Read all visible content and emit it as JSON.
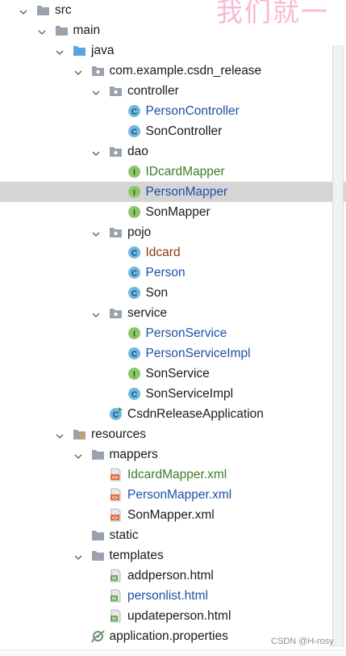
{
  "watermark": {
    "top": "我们就一",
    "bottom": "CSDN @H-rosy"
  },
  "tree": [
    {
      "label": "src",
      "depth": 0,
      "expanded": true,
      "icon": "folder-icon"
    },
    {
      "label": "main",
      "depth": 1,
      "expanded": true,
      "icon": "folder-icon"
    },
    {
      "label": "java",
      "depth": 2,
      "expanded": true,
      "icon": "source-folder-icon"
    },
    {
      "label": "com.example.csdn_release",
      "depth": 3,
      "expanded": true,
      "icon": "package-icon"
    },
    {
      "label": "controller",
      "depth": 4,
      "expanded": true,
      "icon": "package-icon"
    },
    {
      "label": "PersonController",
      "depth": 5,
      "icon": "class-icon",
      "color": "blue"
    },
    {
      "label": "SonController",
      "depth": 5,
      "icon": "class-icon"
    },
    {
      "label": "dao",
      "depth": 4,
      "expanded": true,
      "icon": "package-icon"
    },
    {
      "label": "IDcardMapper",
      "depth": 5,
      "icon": "interface-icon",
      "color": "green"
    },
    {
      "label": "PersonMapper",
      "depth": 5,
      "icon": "interface-icon",
      "color": "blue",
      "selected": true
    },
    {
      "label": "SonMapper",
      "depth": 5,
      "icon": "interface-icon"
    },
    {
      "label": "pojo",
      "depth": 4,
      "expanded": true,
      "icon": "package-icon"
    },
    {
      "label": "Idcard",
      "depth": 5,
      "icon": "class-icon",
      "color": "brown"
    },
    {
      "label": "Person",
      "depth": 5,
      "icon": "class-icon",
      "color": "blue"
    },
    {
      "label": "Son",
      "depth": 5,
      "icon": "class-icon"
    },
    {
      "label": "service",
      "depth": 4,
      "expanded": true,
      "icon": "package-icon"
    },
    {
      "label": "PersonService",
      "depth": 5,
      "icon": "interface-icon",
      "color": "blue"
    },
    {
      "label": "PersonServiceImpl",
      "depth": 5,
      "icon": "class-icon",
      "color": "blue"
    },
    {
      "label": "SonService",
      "depth": 5,
      "icon": "interface-icon"
    },
    {
      "label": "SonServiceImpl",
      "depth": 5,
      "icon": "class-icon"
    },
    {
      "label": "CsdnReleaseApplication",
      "depth": 4,
      "icon": "spring-boot-class-icon"
    },
    {
      "label": "resources",
      "depth": 2,
      "expanded": true,
      "icon": "resources-folder-icon"
    },
    {
      "label": "mappers",
      "depth": 3,
      "expanded": true,
      "icon": "folder-icon"
    },
    {
      "label": "IdcardMapper.xml",
      "depth": 4,
      "icon": "xml-file-icon",
      "color": "green"
    },
    {
      "label": "PersonMapper.xml",
      "depth": 4,
      "icon": "xml-file-icon",
      "color": "blue"
    },
    {
      "label": "SonMapper.xml",
      "depth": 4,
      "icon": "xml-file-icon"
    },
    {
      "label": "static",
      "depth": 3,
      "icon": "folder-icon"
    },
    {
      "label": "templates",
      "depth": 3,
      "expanded": true,
      "icon": "folder-icon"
    },
    {
      "label": "addperson.html",
      "depth": 4,
      "icon": "html-file-icon"
    },
    {
      "label": "personlist.html",
      "depth": 4,
      "icon": "html-file-icon",
      "color": "blue"
    },
    {
      "label": "updateperson.html",
      "depth": 4,
      "icon": "html-file-icon"
    },
    {
      "label": "application.properties",
      "depth": 3,
      "icon": "properties-file-icon"
    }
  ]
}
